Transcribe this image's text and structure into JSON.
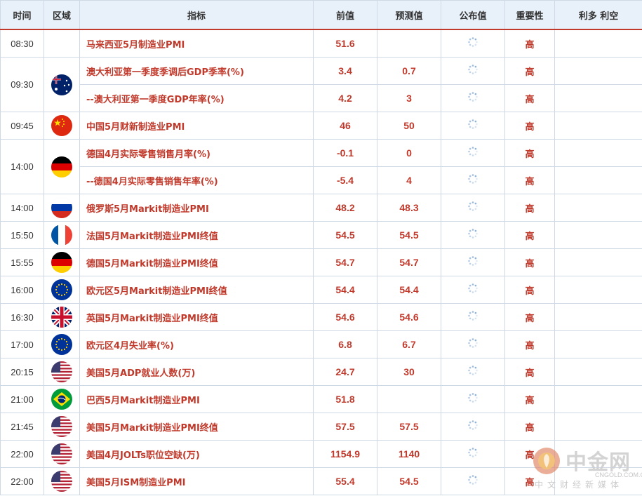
{
  "headers": [
    "时间",
    "区域",
    "指标",
    "前值",
    "预测值",
    "公布值",
    "重要性",
    "利多 利空"
  ],
  "rows": [
    {
      "time": "08:30",
      "flag": "malaysia",
      "name": "马来西亚5月制造业PMI",
      "prev": "51.6",
      "forecast": "",
      "actual": "",
      "importance": "高",
      "impact": ""
    },
    {
      "time": "09:30",
      "flag": "australia-flag-icon",
      "name": "澳大利亚第一季度季调后GDP季率(%)",
      "prev": "3.4",
      "forecast": "0.7",
      "actual": "",
      "importance": "高",
      "impact": ""
    },
    {
      "time": "",
      "flag": "",
      "name": "--澳大利亚第一季度GDP年率(%)",
      "prev": "4.2",
      "forecast": "3",
      "actual": "",
      "importance": "高",
      "impact": ""
    },
    {
      "time": "09:45",
      "flag": "china-flag-icon",
      "name": "中国5月财新制造业PMI",
      "prev": "46",
      "forecast": "50",
      "actual": "",
      "importance": "高",
      "impact": ""
    },
    {
      "time": "14:00",
      "flag": "germany-flag-icon",
      "name": "德国4月实际零售销售月率(%)",
      "prev": "-0.1",
      "forecast": "0",
      "actual": "",
      "importance": "高",
      "impact": ""
    },
    {
      "time": "",
      "flag": "",
      "name": "--德国4月实际零售销售年率(%)",
      "prev": "-5.4",
      "forecast": "4",
      "actual": "",
      "importance": "高",
      "impact": ""
    },
    {
      "time": "14:00",
      "flag": "russia-flag-icon",
      "name": "俄罗斯5月Markit制造业PMI",
      "prev": "48.2",
      "forecast": "48.3",
      "actual": "",
      "importance": "高",
      "impact": ""
    },
    {
      "time": "15:50",
      "flag": "france-flag-icon",
      "name": "法国5月Markit制造业PMI终值",
      "prev": "54.5",
      "forecast": "54.5",
      "actual": "",
      "importance": "高",
      "impact": ""
    },
    {
      "time": "15:55",
      "flag": "germany-flag-icon",
      "name": "德国5月Markit制造业PMI终值",
      "prev": "54.7",
      "forecast": "54.7",
      "actual": "",
      "importance": "高",
      "impact": ""
    },
    {
      "time": "16:00",
      "flag": "eu-flag-icon",
      "name": "欧元区5月Markit制造业PMI终值",
      "prev": "54.4",
      "forecast": "54.4",
      "actual": "",
      "importance": "高",
      "impact": ""
    },
    {
      "time": "16:30",
      "flag": "uk-flag-icon",
      "name": "英国5月Markit制造业PMI终值",
      "prev": "54.6",
      "forecast": "54.6",
      "actual": "",
      "importance": "高",
      "impact": ""
    },
    {
      "time": "17:00",
      "flag": "eu-flag-icon",
      "name": "欧元区4月失业率(%)",
      "prev": "6.8",
      "forecast": "6.7",
      "actual": "",
      "importance": "高",
      "impact": ""
    },
    {
      "time": "20:15",
      "flag": "usa-flag-icon",
      "name": "美国5月ADP就业人数(万)",
      "prev": "24.7",
      "forecast": "30",
      "actual": "",
      "importance": "高",
      "impact": ""
    },
    {
      "time": "21:00",
      "flag": "brazil-flag-icon",
      "name": "巴西5月Markit制造业PMI",
      "prev": "51.8",
      "forecast": "",
      "actual": "",
      "importance": "高",
      "impact": ""
    },
    {
      "time": "21:45",
      "flag": "usa-flag-icon",
      "name": "美国5月Markit制造业PMI终值",
      "prev": "57.5",
      "forecast": "57.5",
      "actual": "",
      "importance": "高",
      "impact": ""
    },
    {
      "time": "22:00",
      "flag": "usa-flag-icon",
      "name": "美国4月JOLTs职位空缺(万)",
      "prev": "1154.9",
      "forecast": "1140",
      "actual": "",
      "importance": "高",
      "impact": ""
    },
    {
      "time": "22:00",
      "flag": "usa-flag-icon",
      "name": "美国5月ISM制造业PMI",
      "prev": "55.4",
      "forecast": "54.5",
      "actual": "",
      "importance": "高",
      "impact": ""
    }
  ],
  "watermark": {
    "brand": "中金网",
    "url": "CNGOLD.COM.CN",
    "slogan": "中文财经新媒体"
  },
  "colors": {
    "accent": "#c0392b",
    "header_bg": "#e8f0f9",
    "border": "#cfd9e6"
  }
}
